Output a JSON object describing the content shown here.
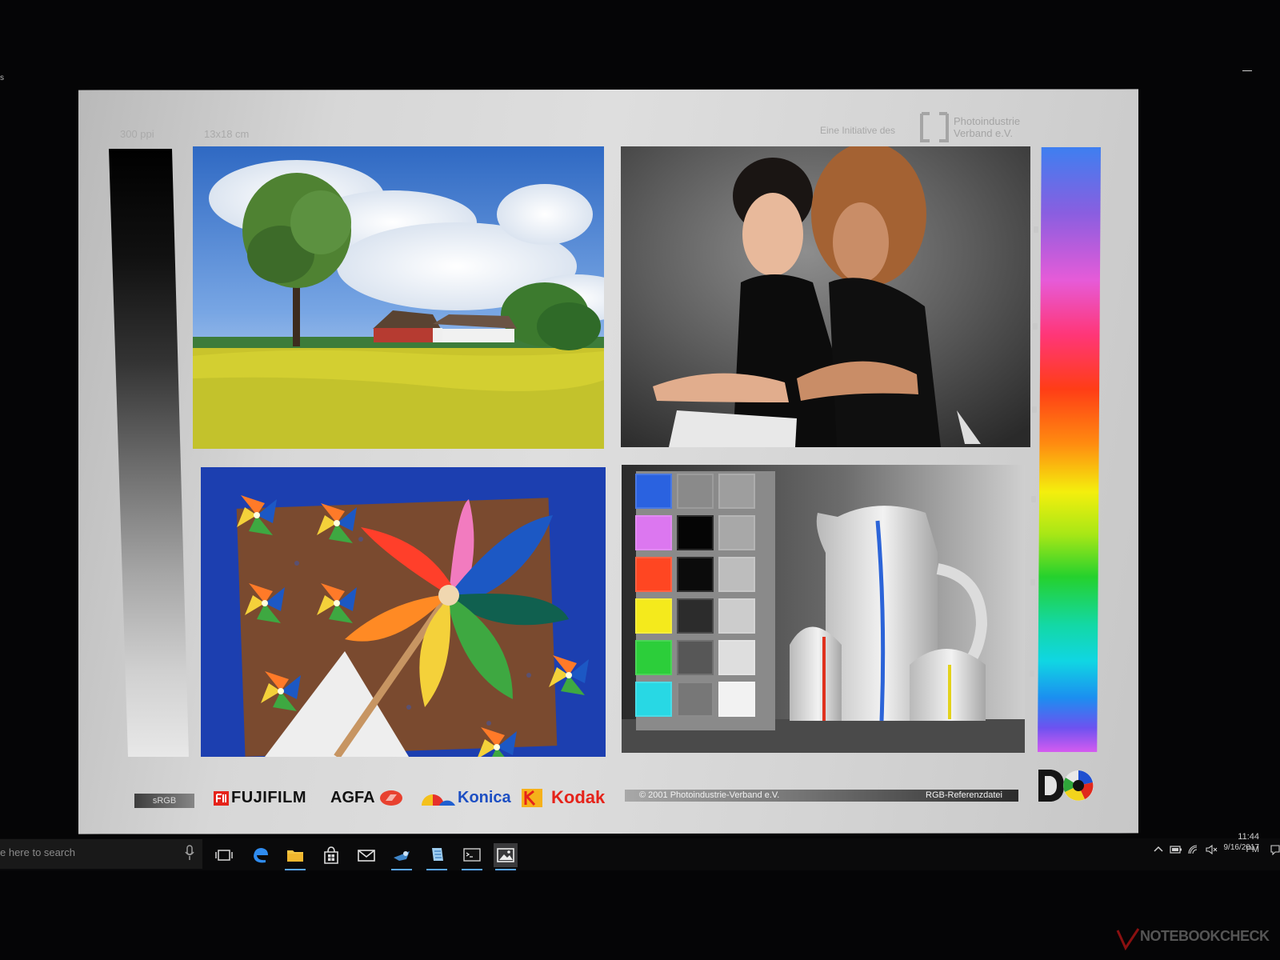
{
  "screen": {
    "window_label_fragment": "s"
  },
  "chart_page": {
    "resolution": "300 ppi",
    "print_size": "13x18 cm",
    "initiative_label": "Eine Initiative des",
    "organization_line1": "Photoindustrie",
    "organization_line2": "Verband e.V.",
    "color_space_badge": "sRGB",
    "brands": [
      "FUJIFILM",
      "AGFA",
      "Konica",
      "Kodak"
    ],
    "copyright": "© 2001 Photoindustrie-Verband e.V.",
    "file_label": "RGB-Referenzdatei",
    "swatch_colors": [
      "#2a62e0",
      "#dc77f0",
      "#ff4622",
      "#f4ea1c",
      "#2cce3a",
      "#28d8e4"
    ],
    "gray_swatches": [
      "#8a8a8a",
      "#050505",
      "#0b0b0b",
      "#2c2c2c",
      "#575757",
      "#777777"
    ],
    "light_swatches": [
      "#9e9e9e",
      "#a8a8a8",
      "#bdbdbd",
      "#cccccc",
      "#dedede",
      "#f2f2f2"
    ]
  },
  "taskbar": {
    "search_placeholder": "e here to search",
    "time": "11:44 PM",
    "date": "9/16/2017",
    "icons": [
      "task-view-icon",
      "edge-icon",
      "file-explorer-icon",
      "store-icon",
      "mail-icon",
      "steam-icon",
      "notepad-icon",
      "command-prompt-icon",
      "photos-icon"
    ]
  },
  "watermark": {
    "text": "NOTEBOOKCHECK"
  }
}
